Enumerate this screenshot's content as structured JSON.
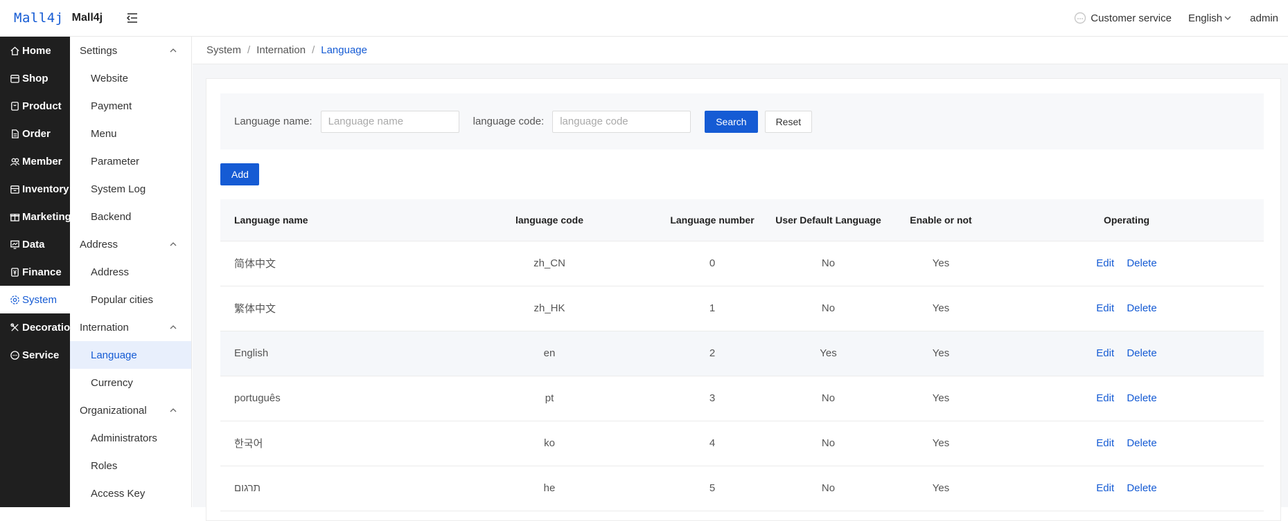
{
  "header": {
    "logo_mark": "Mall4j",
    "app_name": "Mall4j",
    "customer_service": "Customer service",
    "language": "English",
    "user": "admin"
  },
  "nav": {
    "items": [
      {
        "label": "Home",
        "icon": "home-icon"
      },
      {
        "label": "Shop",
        "icon": "shop-icon"
      },
      {
        "label": "Product",
        "icon": "product-icon"
      },
      {
        "label": "Order",
        "icon": "order-icon"
      },
      {
        "label": "Member",
        "icon": "member-icon"
      },
      {
        "label": "Inventory",
        "icon": "inventory-icon"
      },
      {
        "label": "Marketing",
        "icon": "marketing-icon"
      },
      {
        "label": "Data",
        "icon": "data-icon"
      },
      {
        "label": "Finance",
        "icon": "finance-icon"
      },
      {
        "label": "System",
        "icon": "gear-icon"
      },
      {
        "label": "Decoration",
        "icon": "decoration-icon"
      },
      {
        "label": "Service",
        "icon": "chat-icon"
      }
    ]
  },
  "submenu": {
    "settings": {
      "label": "Settings",
      "items": [
        "Website",
        "Payment",
        "Menu",
        "Parameter",
        "System Log",
        "Backend"
      ]
    },
    "address": {
      "label": "Address",
      "items": [
        "Address",
        "Popular cities"
      ]
    },
    "internation": {
      "label": "Internation",
      "items": [
        "Language",
        "Currency"
      ]
    },
    "organizational": {
      "label": "Organizational",
      "items": [
        "Administrators",
        "Roles",
        "Access Key"
      ]
    }
  },
  "breadcrumb": {
    "level1": "System",
    "level2": "Internation",
    "level3": "Language",
    "separator": "/"
  },
  "search": {
    "name_label": "Language name:",
    "name_placeholder": "Language name",
    "code_label": "language code:",
    "code_placeholder": "language code",
    "search_label": "Search",
    "reset_label": "Reset"
  },
  "add_label": "Add",
  "table": {
    "columns": [
      "Language name",
      "language code",
      "Language number",
      "User Default Language",
      "Enable or not",
      "Operating"
    ],
    "edit_label": "Edit",
    "delete_label": "Delete",
    "rows": [
      {
        "name": "简体中文",
        "code": "zh_CN",
        "number": "0",
        "default": "No",
        "enabled": "Yes"
      },
      {
        "name": "繁体中文",
        "code": "zh_HK",
        "number": "1",
        "default": "No",
        "enabled": "Yes"
      },
      {
        "name": "English",
        "code": "en",
        "number": "2",
        "default": "Yes",
        "enabled": "Yes"
      },
      {
        "name": "português",
        "code": "pt",
        "number": "3",
        "default": "No",
        "enabled": "Yes"
      },
      {
        "name": "한국어",
        "code": "ko",
        "number": "4",
        "default": "No",
        "enabled": "Yes"
      },
      {
        "name": "תרגום",
        "code": "he",
        "number": "5",
        "default": "No",
        "enabled": "Yes"
      }
    ]
  },
  "colors": {
    "accent": "#155bd4",
    "nav_bg": "#1f1f1f"
  }
}
